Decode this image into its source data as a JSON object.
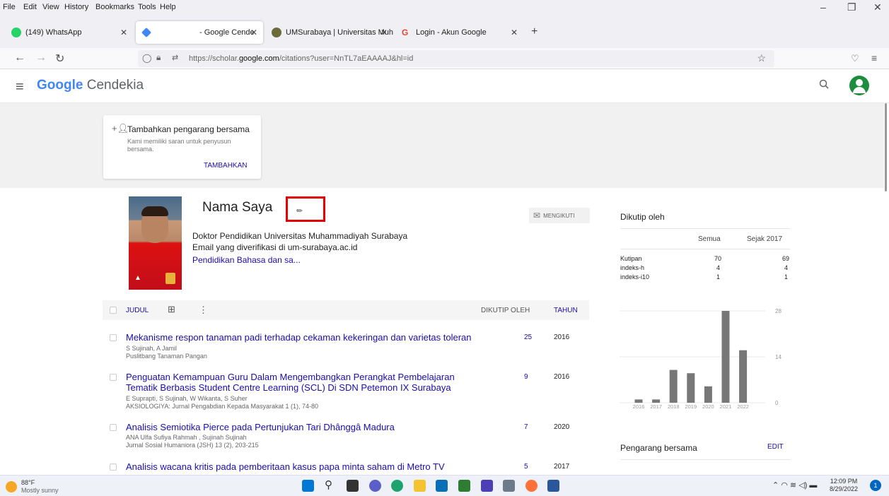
{
  "browser": {
    "menu": [
      "File",
      "Edit",
      "View",
      "History",
      "Bookmarks",
      "Tools",
      "Help"
    ],
    "tabs": [
      {
        "label": "(149) WhatsApp",
        "color": "#25d366"
      },
      {
        "label": "- Google Cende",
        "color": "#4285f4"
      },
      {
        "label": "UMSurabaya | Universitas Muha",
        "color": "#6b6b3a"
      },
      {
        "label": "Login - Akun Google",
        "color": "#ea4335"
      }
    ],
    "url_prefix": "https://scholar.",
    "url_domain": "google.com",
    "url_suffix": "/citations?user=NnTL7aEAAAAJ&hl=id"
  },
  "header": {
    "logo_brand": "Google",
    "logo_rest": " Cendekia"
  },
  "coauthor_card": {
    "title": "Tambahkan pengarang bersama",
    "description": "Kami memiliki saran untuk penyusun bersama.",
    "button": "TAMBAHKAN"
  },
  "profile": {
    "name": "Nama Saya",
    "affiliation": "Doktor Pendidikan Universitas Muhammadiyah Surabaya",
    "email": "Email yang diverifikasi di um-surabaya.ac.id",
    "interest": "Pendidikan Bahasa dan sa...",
    "follow_label": "MENGIKUTI"
  },
  "table": {
    "col_title": "JUDUL",
    "col_cited": "DIKUTIP OLEH",
    "col_year": "TAHUN",
    "rows": [
      {
        "title": "Mekanisme respon tanaman padi terhadap cekaman kekeringan dan varietas toleran",
        "authors": "S Sujinah, A Jamil",
        "venue": "Puslitbang Tanaman Pangan",
        "cited": "25",
        "year": "2016"
      },
      {
        "title": "Penguatan Kemampuan Guru Dalam Mengembangkan Perangkat Pembelajaran Tematik Berbasis Student Centre Learning (SCL) Di SDN Petemon IX Surabaya",
        "authors": "E Suprapti, S Sujinah, W Wikanta, S Suher",
        "venue": "AKSIOLOGIYA: Jurnal Pengabdian Kepada Masyarakat 1 (1), 74-80",
        "cited": "9",
        "year": "2016"
      },
      {
        "title": "Analisis Semiotika Pierce pada Pertunjukan Tari Dhânggâ Madura",
        "authors": "ANA Ulfa Sufiya Rahmah , Sujinah Sujinah",
        "venue": "Jurnal Sosial Humaniora (JSH) 13 (2), 203-215",
        "cited": "7",
        "year": "2020"
      },
      {
        "title": "Analisis wacana kritis pada pemberitaan kasus papa minta saham di Metro TV",
        "authors": "",
        "venue": "",
        "cited": "5",
        "year": "2017"
      }
    ]
  },
  "cited_by": {
    "title": "Dikutip oleh",
    "col_all": "Semua",
    "col_since": "Sejak 2017",
    "rows": [
      {
        "label": "Kutipan",
        "all": "70",
        "since": "69"
      },
      {
        "label": "indeks-h",
        "all": "4",
        "since": "4"
      },
      {
        "label": "indeks-i10",
        "all": "1",
        "since": "1"
      }
    ]
  },
  "chart_data": {
    "type": "bar",
    "categories": [
      "2016",
      "2017",
      "2018",
      "2019",
      "2020",
      "2021",
      "2022"
    ],
    "values": [
      1,
      1,
      10,
      9,
      5,
      28,
      16
    ],
    "yticks": [
      "28",
      "14",
      "0"
    ],
    "ylim": [
      0,
      28
    ],
    "bar_color": "#777777"
  },
  "coauthors": {
    "title": "Pengarang bersama",
    "edit": "EDIT"
  },
  "taskbar": {
    "temp": "88°F",
    "condition": "Mostly sunny",
    "time": "12:09 PM",
    "date": "8/29/2022",
    "notifications": "1"
  }
}
